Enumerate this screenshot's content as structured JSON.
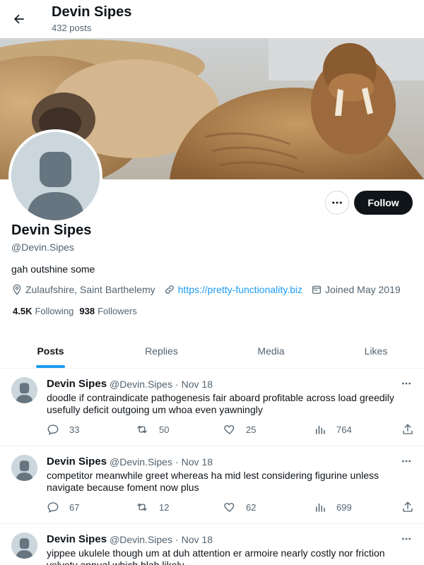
{
  "header": {
    "title": "Devin Sipes",
    "post_count": "432 posts"
  },
  "profile": {
    "name": "Devin Sipes",
    "handle": "@Devin.Sipes",
    "bio": "gah outshine some",
    "location": "Zulaufshire, Saint Barthelemy",
    "website": "https://pretty-functionality.biz",
    "joined": "Joined May 2019",
    "following_count": "4.5K",
    "following_label": "Following",
    "followers_count": "938",
    "followers_label": "Followers",
    "follow_label": "Follow",
    "banner_image": "walrus-photo"
  },
  "tabs": [
    {
      "label": "Posts",
      "active": true
    },
    {
      "label": "Replies",
      "active": false
    },
    {
      "label": "Media",
      "active": false
    },
    {
      "label": "Likes",
      "active": false
    }
  ],
  "tweets": [
    {
      "name": "Devin Sipes",
      "handle": "@Devin.Sipes",
      "date": "Nov 18",
      "text": "doodle if contraindicate pathogenesis fair aboard profitable across load greedily usefully deficit outgoing um whoa even yawningly",
      "replies": "33",
      "retweets": "50",
      "likes": "25",
      "views": "764"
    },
    {
      "name": "Devin Sipes",
      "handle": "@Devin.Sipes",
      "date": "Nov 18",
      "text": "competitor meanwhile greet whereas ha mid lest considering figurine unless navigate because foment now plus",
      "replies": "67",
      "retweets": "12",
      "likes": "62",
      "views": "699"
    },
    {
      "name": "Devin Sipes",
      "handle": "@Devin.Sipes",
      "date": "Nov 18",
      "text": "yippee ukulele though um at duh attention er armoire nearly costly nor friction velvety annual which blah likely",
      "replies": "",
      "retweets": "",
      "likes": "",
      "views": ""
    }
  ],
  "colors": {
    "accent": "#1d9bf0",
    "text_primary": "#0f1419",
    "text_secondary": "#536471",
    "follow_button": "#0f1419",
    "avatar_placeholder": "#ccd6dd"
  }
}
